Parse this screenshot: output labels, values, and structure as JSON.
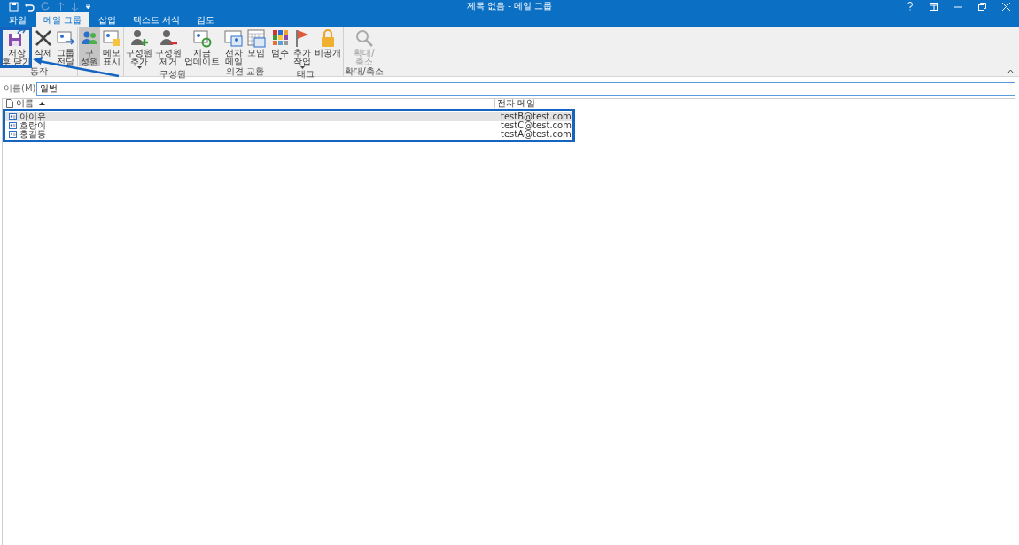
{
  "window": {
    "title": "제목 없음 - 메일 그룹"
  },
  "tabs": [
    {
      "label": "파일",
      "selected": false
    },
    {
      "label": "메일 그룹",
      "selected": true
    },
    {
      "label": "삽입",
      "selected": false
    },
    {
      "label": "텍스트 서식",
      "selected": false
    },
    {
      "label": "검토",
      "selected": false
    }
  ],
  "ribbon_groups": [
    {
      "label": "동작",
      "buttons": [
        {
          "lines": [
            "저장",
            "후 닫기"
          ],
          "selected": false,
          "disabled": false,
          "dropdown": false
        },
        {
          "lines": [
            "삭제"
          ],
          "selected": false,
          "disabled": false,
          "dropdown": false
        },
        {
          "lines": [
            "그룹",
            "전달"
          ],
          "selected": false,
          "disabled": false,
          "dropdown": false
        }
      ]
    },
    {
      "buttons": [
        {
          "lines": [
            "구",
            "성원"
          ],
          "selected": true,
          "disabled": false,
          "dropdown": false
        },
        {
          "lines": [
            "메모",
            "표시"
          ],
          "selected": false,
          "disabled": false,
          "dropdown": false
        }
      ]
    },
    {
      "label": "구성원",
      "buttons": [
        {
          "lines": [
            "구성원",
            "추가"
          ],
          "selected": false,
          "disabled": false,
          "dropdown": true
        },
        {
          "lines": [
            "구성원",
            "제거"
          ],
          "selected": false,
          "disabled": false,
          "dropdown": false
        },
        {
          "lines": [
            "지금",
            "업데이트"
          ],
          "selected": false,
          "disabled": false,
          "dropdown": false
        }
      ]
    },
    {
      "label": "의견 교환",
      "buttons": [
        {
          "lines": [
            "전자",
            "메일"
          ],
          "selected": false,
          "disabled": false,
          "dropdown": false
        },
        {
          "lines": [
            "모임"
          ],
          "selected": false,
          "disabled": false,
          "dropdown": false
        }
      ]
    },
    {
      "label": "태그",
      "buttons": [
        {
          "lines": [
            "범주"
          ],
          "selected": false,
          "disabled": false,
          "dropdown": true
        },
        {
          "lines": [
            "추가",
            "작업"
          ],
          "selected": false,
          "disabled": false,
          "dropdown": true
        },
        {
          "lines": [
            "비공개"
          ],
          "selected": false,
          "disabled": false,
          "dropdown": false
        }
      ]
    },
    {
      "label": "확대/축소",
      "buttons": [
        {
          "lines": [
            "확대/",
            "축소"
          ],
          "selected": false,
          "disabled": true,
          "dropdown": false
        }
      ]
    }
  ],
  "name_field": {
    "label": "이름(M)",
    "value": "일번"
  },
  "table": {
    "columns": [
      {
        "label": "이름",
        "sorted": true
      },
      {
        "label": "전자 메일",
        "sorted": false
      }
    ],
    "rows": [
      {
        "name": "아이유",
        "email": "testB@test.com",
        "selected": true
      },
      {
        "name": "호랑이",
        "email": "testC@test.com",
        "selected": false
      },
      {
        "name": "홍길동",
        "email": "testA@test.com",
        "selected": false
      }
    ]
  }
}
